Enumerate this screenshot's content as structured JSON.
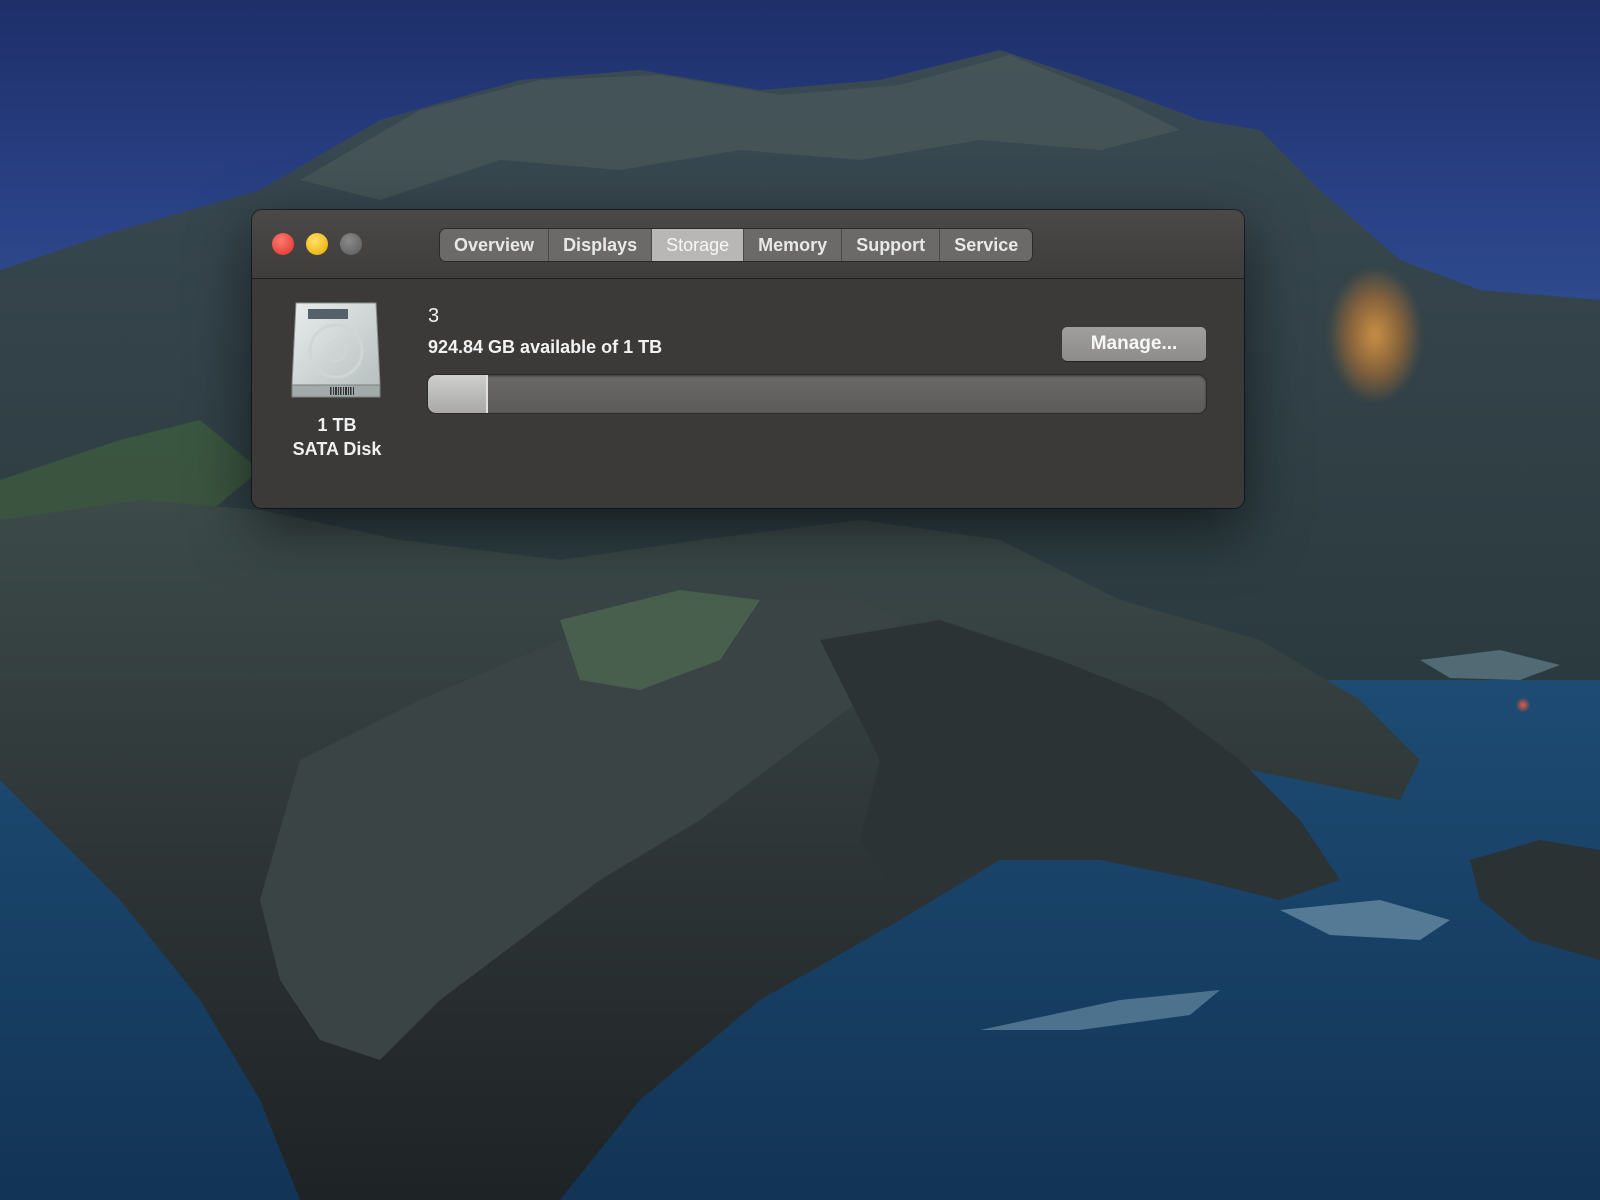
{
  "window": {
    "controls": {
      "close": "close-icon",
      "minimize": "minimize-icon",
      "zoom": "zoom-icon"
    },
    "tabs": [
      {
        "label": "Overview",
        "active": false
      },
      {
        "label": "Displays",
        "active": false
      },
      {
        "label": "Storage",
        "active": true
      },
      {
        "label": "Memory",
        "active": false
      },
      {
        "label": "Support",
        "active": false
      },
      {
        "label": "Service",
        "active": false
      }
    ]
  },
  "storage": {
    "disk_icon": "hard-disk-icon",
    "disk_size": "1 TB",
    "disk_type": "SATA Disk",
    "volume_name": "3",
    "available_text": "924.84 GB available of 1 TB",
    "manage_label": "Manage...",
    "used_fraction": 0.075
  },
  "colors": {
    "close": "#e6463d",
    "minimize": "#f0b91c",
    "zoom_inactive": "#686868",
    "window_bg": "#3b3a39"
  }
}
